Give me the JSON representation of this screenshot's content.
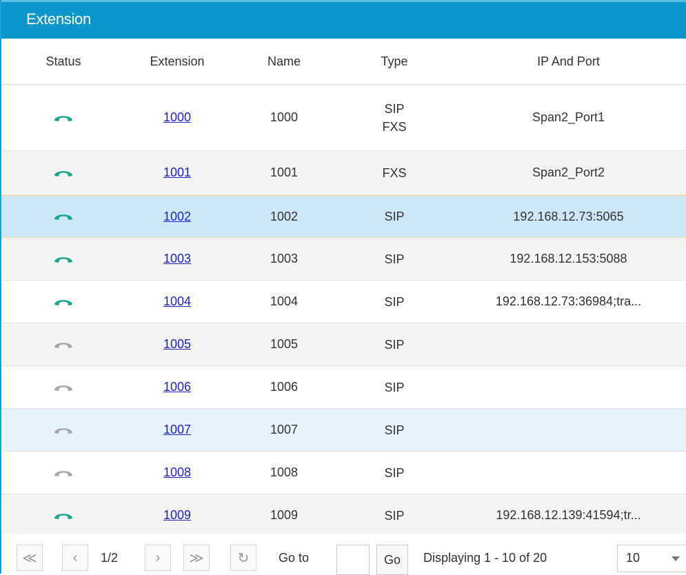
{
  "panel": {
    "title": "Extension"
  },
  "columns": {
    "status": "Status",
    "extension": "Extension",
    "name": "Name",
    "type": "Type",
    "ip_port": "IP And Port"
  },
  "colors": {
    "online": "#16a58a",
    "offline": "#a6a6a6",
    "link": "#2222cc",
    "header_bg": "#0b97cd",
    "selected_row": "#cde7f8"
  },
  "rows": [
    {
      "status": "online",
      "status_icon": "phone-online-icon",
      "extension": "1000",
      "name": "1000",
      "type": [
        "SIP",
        "FXS"
      ],
      "ip_port": "Span2_Port1"
    },
    {
      "status": "online",
      "status_icon": "phone-online-icon",
      "extension": "1001",
      "name": "1001",
      "type": [
        "FXS"
      ],
      "ip_port": "Span2_Port2"
    },
    {
      "status": "online",
      "status_icon": "phone-online-icon",
      "extension": "1002",
      "name": "1002",
      "type": [
        "SIP"
      ],
      "ip_port": "192.168.12.73:5065"
    },
    {
      "status": "online",
      "status_icon": "phone-online-icon",
      "extension": "1003",
      "name": "1003",
      "type": [
        "SIP"
      ],
      "ip_port": "192.168.12.153:5088"
    },
    {
      "status": "online",
      "status_icon": "phone-online-icon",
      "extension": "1004",
      "name": "1004",
      "type": [
        "SIP"
      ],
      "ip_port": "192.168.12.73:36984;tra..."
    },
    {
      "status": "offline",
      "status_icon": "phone-offline-icon",
      "extension": "1005",
      "name": "1005",
      "type": [
        "SIP"
      ],
      "ip_port": ""
    },
    {
      "status": "offline",
      "status_icon": "phone-offline-icon",
      "extension": "1006",
      "name": "1006",
      "type": [
        "SIP"
      ],
      "ip_port": ""
    },
    {
      "status": "offline",
      "status_icon": "phone-offline-icon",
      "extension": "1007",
      "name": "1007",
      "type": [
        "SIP"
      ],
      "ip_port": ""
    },
    {
      "status": "offline",
      "status_icon": "phone-offline-icon",
      "extension": "1008",
      "name": "1008",
      "type": [
        "SIP"
      ],
      "ip_port": ""
    },
    {
      "status": "online",
      "status_icon": "phone-online-icon",
      "extension": "1009",
      "name": "1009",
      "type": [
        "SIP"
      ],
      "ip_port": "192.168.12.139:41594;tr..."
    }
  ],
  "pager": {
    "first_icon": "double-chevron-left-icon",
    "prev_icon": "chevron-left-icon",
    "page_indicator": "1/2",
    "next_icon": "chevron-right-icon",
    "last_icon": "double-chevron-right-icon",
    "refresh_icon": "refresh-icon",
    "goto_label": "Go to",
    "goto_value": "",
    "go_label": "Go",
    "display_text": "Displaying 1 - 10 of 20",
    "page_size": "10"
  }
}
